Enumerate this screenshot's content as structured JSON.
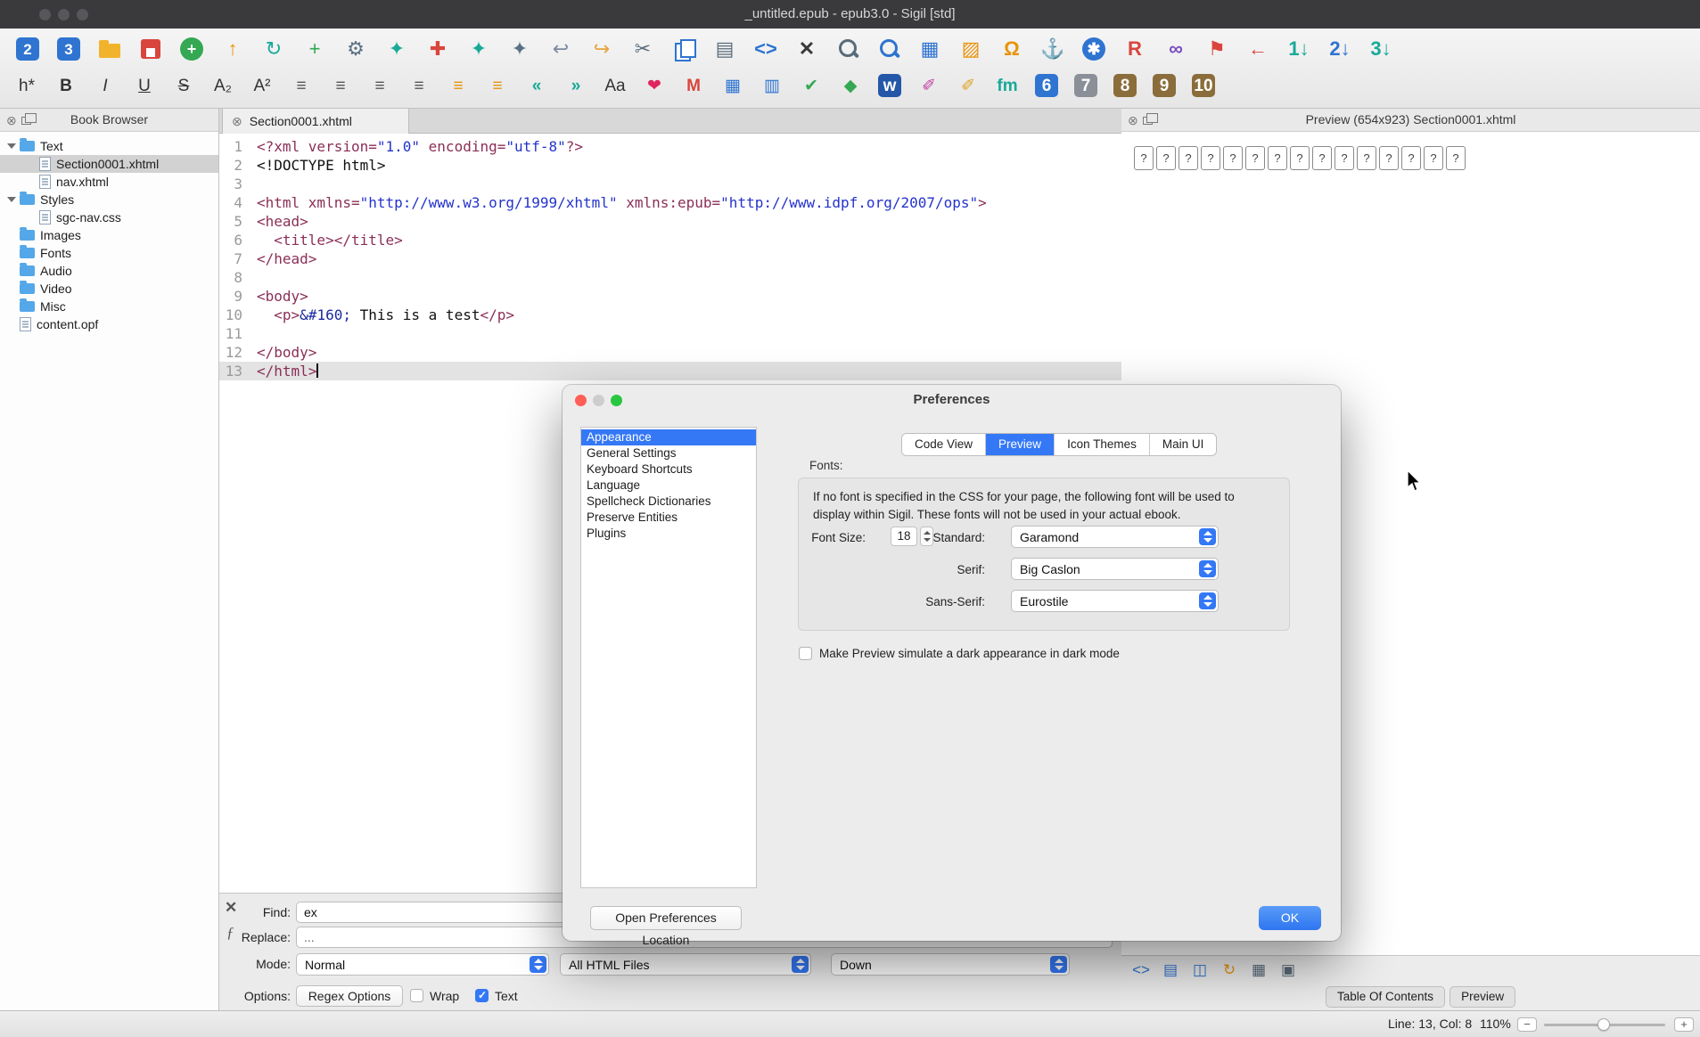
{
  "window": {
    "title": "_untitled.epub - epub3.0 - Sigil [std]"
  },
  "toolbar": {
    "row1": [
      {
        "n": "epub2",
        "g": "2",
        "bg": "#2f74d0",
        "c": "#ffffff"
      },
      {
        "n": "epub3",
        "g": "3",
        "bg": "#2f74d0",
        "c": "#ffffff"
      },
      {
        "n": "open",
        "kind": "folder"
      },
      {
        "n": "save",
        "kind": "floppy"
      },
      {
        "n": "add-existing-files",
        "g": "+",
        "bg": "#34a853",
        "c": "#ffffff",
        "round": true
      },
      {
        "n": "arrow-up",
        "g": "↑",
        "c": "#e8930c"
      },
      {
        "n": "refresh",
        "g": "↻",
        "c": "#18a999"
      },
      {
        "n": "add",
        "g": "+",
        "c": "#34a853"
      },
      {
        "n": "settings-gear",
        "g": "⚙",
        "c": "#5b7083"
      },
      {
        "n": "tool-teal-1",
        "g": "✦",
        "c": "#18a999"
      },
      {
        "n": "tool-red",
        "g": "✚",
        "c": "#d9453d"
      },
      {
        "n": "tool-teal-2",
        "g": "✦",
        "c": "#18a999"
      },
      {
        "n": "tool-gray",
        "g": "✦",
        "c": "#5b7083"
      },
      {
        "n": "undo",
        "g": "↩",
        "c": "#7d8aa0"
      },
      {
        "n": "redo",
        "g": "↪",
        "c": "#e8a33d"
      },
      {
        "n": "cut",
        "g": "✂",
        "c": "#5a6b7a"
      },
      {
        "n": "copy",
        "kind": "copy"
      },
      {
        "n": "paste",
        "g": "▤",
        "c": "#5a6b7a"
      },
      {
        "n": "code-view",
        "g": "<>",
        "c": "#2f74d0",
        "cls": "b"
      },
      {
        "n": "delete",
        "g": "✕",
        "c": "#3a3a3a",
        "cls": "b"
      },
      {
        "n": "find",
        "kind": "mag"
      },
      {
        "n": "find-next",
        "kind": "magplus"
      },
      {
        "n": "split-window",
        "g": "▦",
        "c": "#2f74d0"
      },
      {
        "n": "insert-image",
        "g": "▨",
        "c": "#e8930c"
      },
      {
        "n": "special-characters",
        "g": "Ω",
        "c": "#e8930c",
        "cls": "b"
      },
      {
        "n": "insert-anchor",
        "g": "⚓",
        "c": "#2f74d0"
      },
      {
        "n": "validate-epub",
        "g": "✱",
        "bg": "#2f74d0",
        "c": "#ffffff",
        "round": true
      },
      {
        "n": "run-plugin",
        "g": "R",
        "c": "#d9453d",
        "cls": "b"
      },
      {
        "n": "insert-link",
        "g": "∞",
        "c": "#7a4dbf",
        "cls": "b"
      },
      {
        "n": "bookmark",
        "g": "⚑",
        "c": "#d9453d"
      },
      {
        "n": "back",
        "g": "←",
        "c": "#d9453d",
        "cls": "b"
      },
      {
        "n": "mend-1",
        "g": "1↓",
        "c": "#18a999",
        "cls": "b"
      },
      {
        "n": "mend-2",
        "g": "2↓",
        "c": "#2f74d0",
        "cls": "b"
      },
      {
        "n": "mend-3",
        "g": "3↓",
        "c": "#18a999",
        "cls": "b"
      }
    ],
    "row2": [
      {
        "n": "heading",
        "g": "h*",
        "c": "#333333"
      },
      {
        "n": "bold",
        "g": "B",
        "c": "#333333",
        "cls": "b"
      },
      {
        "n": "italic",
        "g": "I",
        "c": "#333333",
        "cls": "i"
      },
      {
        "n": "underline",
        "g": "U",
        "c": "#333333",
        "cls": "u"
      },
      {
        "n": "strikethrough",
        "g": "S",
        "c": "#333333",
        "cls": "st"
      },
      {
        "n": "subscript",
        "g": "A₂",
        "c": "#333333"
      },
      {
        "n": "superscript",
        "g": "A²",
        "c": "#333333"
      },
      {
        "n": "align-left",
        "g": "≡",
        "c": "#555555"
      },
      {
        "n": "align-center",
        "g": "≡",
        "c": "#555555"
      },
      {
        "n": "align-right",
        "g": "≡",
        "c": "#555555"
      },
      {
        "n": "justify",
        "g": "≡",
        "c": "#555555"
      },
      {
        "n": "bullet-list",
        "g": "≡",
        "c": "#e8930c"
      },
      {
        "n": "numbered-list",
        "g": "≡",
        "c": "#e8930c"
      },
      {
        "n": "outdent",
        "g": "«",
        "c": "#18a999",
        "cls": "b"
      },
      {
        "n": "indent",
        "g": "»",
        "c": "#18a999",
        "cls": "b"
      },
      {
        "n": "change-case",
        "g": "Aa",
        "c": "#333333"
      },
      {
        "n": "heart",
        "g": "❤",
        "c": "#e0245e"
      },
      {
        "n": "metadata",
        "g": "M",
        "c": "#d9453d",
        "cls": "b"
      },
      {
        "n": "table",
        "g": "▦",
        "c": "#2f74d0"
      },
      {
        "n": "table-alt",
        "g": "▥",
        "c": "#2f74d0"
      },
      {
        "n": "spellcheck",
        "g": "✔",
        "c": "#34a853"
      },
      {
        "n": "ticket",
        "g": "◆",
        "c": "#34a853"
      },
      {
        "n": "word-import",
        "g": "w",
        "bg": "#2457a8",
        "c": "#ffffff"
      },
      {
        "n": "clean-html",
        "g": "✐",
        "c": "#c040a0"
      },
      {
        "n": "clean-css",
        "g": "✐",
        "c": "#e0a020"
      },
      {
        "n": "fm-plugin",
        "g": "fm",
        "c": "#18a999",
        "cls": "b"
      },
      {
        "n": "clip-6",
        "g": "6",
        "bg": "#2f74d0",
        "c": "#ffffff"
      },
      {
        "n": "clip-7",
        "g": "7",
        "bg": "#8a8f98",
        "c": "#ffffff"
      },
      {
        "n": "clip-8",
        "g": "8",
        "bg": "#8a6d3b",
        "c": "#ffffff"
      },
      {
        "n": "clip-9",
        "g": "9",
        "bg": "#8a6d3b",
        "c": "#ffffff"
      },
      {
        "n": "clip-10",
        "g": "10",
        "bg": "#8a6d3b",
        "c": "#ffffff"
      }
    ]
  },
  "book_browser": {
    "title": "Book Browser",
    "items": [
      {
        "label": "Text",
        "type": "folder",
        "expanded": true,
        "indent": 0
      },
      {
        "label": "Section0001.xhtml",
        "type": "file",
        "indent": 1,
        "selected": true
      },
      {
        "label": "nav.xhtml",
        "type": "file",
        "indent": 1
      },
      {
        "label": "Styles",
        "type": "folder",
        "expanded": true,
        "indent": 0
      },
      {
        "label": "sgc-nav.css",
        "type": "file",
        "indent": 1
      },
      {
        "label": "Images",
        "type": "folder",
        "indent": 0
      },
      {
        "label": "Fonts",
        "type": "folder",
        "indent": 0
      },
      {
        "label": "Audio",
        "type": "folder",
        "indent": 0
      },
      {
        "label": "Video",
        "type": "folder",
        "indent": 0
      },
      {
        "label": "Misc",
        "type": "folder",
        "indent": 0
      },
      {
        "label": "content.opf",
        "type": "file",
        "indent": 0
      }
    ]
  },
  "editor": {
    "tab_label": "Section0001.xhtml",
    "current_line": 13,
    "lines": [
      [
        {
          "c": "tag",
          "t": "<?xml version="
        },
        {
          "c": "str",
          "t": "\"1.0\""
        },
        {
          "c": "tag",
          "t": " encoding="
        },
        {
          "c": "str",
          "t": "\"utf-8\""
        },
        {
          "c": "tag",
          "t": "?>"
        }
      ],
      [
        {
          "c": "plain",
          "t": "<!DOCTYPE html>"
        }
      ],
      [],
      [
        {
          "c": "tag",
          "t": "<html xmlns="
        },
        {
          "c": "str",
          "t": "\"http://www.w3.org/1999/xhtml\""
        },
        {
          "c": "tag",
          "t": " xmlns:epub="
        },
        {
          "c": "str",
          "t": "\"http://www.idpf.org/2007/ops\""
        },
        {
          "c": "tag",
          "t": ">"
        }
      ],
      [
        {
          "c": "tag",
          "t": "<head>"
        }
      ],
      [
        {
          "c": "plain",
          "t": "  "
        },
        {
          "c": "tag",
          "t": "<title></title>"
        }
      ],
      [
        {
          "c": "tag",
          "t": "</head>"
        }
      ],
      [],
      [
        {
          "c": "tag",
          "t": "<body>"
        }
      ],
      [
        {
          "c": "plain",
          "t": "  "
        },
        {
          "c": "tag",
          "t": "<p>"
        },
        {
          "c": "ent",
          "t": "&#160;"
        },
        {
          "c": "plain",
          "t": " This is a test"
        },
        {
          "c": "tag",
          "t": "</p>"
        }
      ],
      [],
      [
        {
          "c": "tag",
          "t": "</body>"
        }
      ],
      [
        {
          "c": "tag",
          "t": "</html>"
        }
      ]
    ]
  },
  "preview_panel": {
    "title": "Preview (654x923) Section0001.xhtml",
    "placeholder_char": "?",
    "placeholder_count": 15,
    "bottom_icons": [
      {
        "n": "code-view-toggle",
        "g": "<>",
        "c": "#2f74d0"
      },
      {
        "n": "book-view",
        "g": "▤",
        "c": "#2f74d0"
      },
      {
        "n": "split-pane",
        "g": "◫",
        "c": "#2f74d0"
      },
      {
        "n": "refresh-preview",
        "g": "↻",
        "c": "#e8930c"
      },
      {
        "n": "select-element",
        "g": "▦",
        "c": "#5a6b7a"
      },
      {
        "n": "inspector",
        "g": "▣",
        "c": "#5a6b7a"
      }
    ],
    "tabs": [
      "Table Of Contents",
      "Preview"
    ]
  },
  "find_bar": {
    "find_label": "Find:",
    "find_value": "ex",
    "replace_label": "Replace:",
    "replace_value": "...",
    "mode_label": "Mode:",
    "mode_value": "Normal",
    "scope_value": "All HTML Files",
    "direction_value": "Down",
    "options_label": "Options:",
    "regex_options_label": "Regex Options",
    "wrap_label": "Wrap",
    "text_label": "Text"
  },
  "preferences": {
    "title": "Preferences",
    "categories": [
      "Appearance",
      "General Settings",
      "Keyboard Shortcuts",
      "Language",
      "Spellcheck Dictionaries",
      "Preserve Entities",
      "Plugins"
    ],
    "selected_category": "Appearance",
    "tabs": [
      "Code View",
      "Preview",
      "Icon Themes",
      "Main UI"
    ],
    "selected_tab": "Preview",
    "fonts_group": {
      "label": "Fonts:",
      "desc_line1": "If no font is specified in the CSS for your page, the following font will be used to",
      "desc_line2": "display within Sigil. These fonts will not be used in your actual ebook.",
      "font_size_label": "Font Size:",
      "font_size_value": "18",
      "standard_label": "Standard:",
      "standard_value": "Garamond",
      "serif_label": "Serif:",
      "serif_value": "Big Caslon",
      "sans_serif_label": "Sans-Serif:",
      "sans_serif_value": "Eurostile"
    },
    "dark_mode_checkbox_label": "Make Preview simulate a dark appearance in dark mode",
    "open_location_button": "Open Preferences Location",
    "ok_button": "OK"
  },
  "status_bar": {
    "line_col": "Line: 13, Col: 8",
    "zoom": "110%"
  }
}
